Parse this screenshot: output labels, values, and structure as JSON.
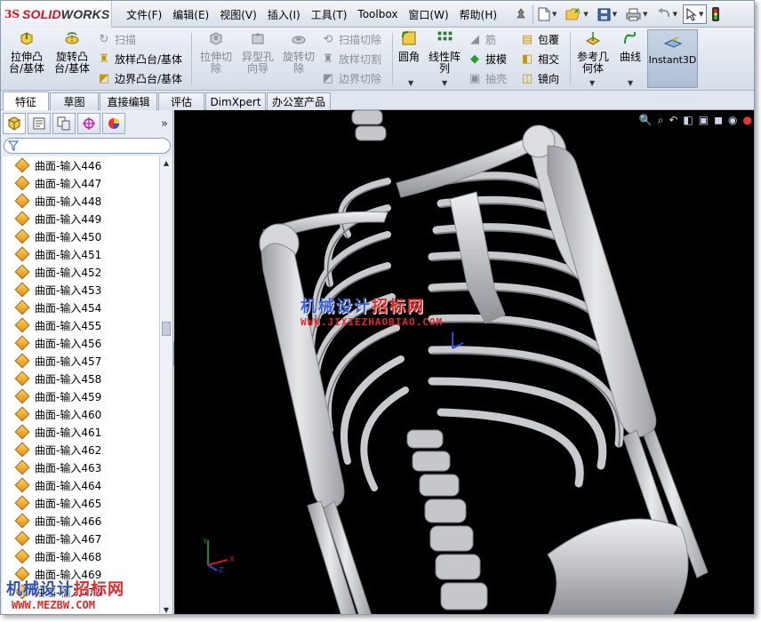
{
  "app": {
    "logo_ds": "3S",
    "logo_solid": "SOLID",
    "logo_works": "WORKS"
  },
  "menu": [
    "文件(F)",
    "编辑(E)",
    "视图(V)",
    "插入(I)",
    "工具(T)",
    "Toolbox",
    "窗口(W)",
    "帮助(H)"
  ],
  "quick_access": [
    {
      "icon": "pin-icon"
    },
    {
      "icon": "new-document-icon"
    },
    {
      "icon": "open-folder-icon"
    },
    {
      "icon": "save-icon"
    },
    {
      "icon": "print-icon"
    },
    {
      "icon": "undo-icon"
    },
    {
      "icon": "select-pointer-icon"
    },
    {
      "icon": "rebuild-traffic-light-icon"
    }
  ],
  "command_manager": {
    "extrude_boss": "拉伸凸\n台/基体",
    "revolve_boss": "旋转凸\n台/基体",
    "sweep": "扫描",
    "loft_boss": "放样凸台/基体",
    "boundary_boss": "边界凸台/基体",
    "extrude_cut": "拉伸切\n除",
    "hole_wizard": "异型孔\n向导",
    "revolve_cut": "旋转切\n除",
    "swept_cut": "扫描切除",
    "lofted_cut": "放样切割",
    "boundary_cut": "边界切除",
    "fillet": "圆角",
    "linear_pattern": "线性阵\n列",
    "rib": "筋",
    "draft": "拔模",
    "shell": "抽壳",
    "wrap": "包覆",
    "intersect": "相交",
    "mirror": "镜向",
    "ref_geometry": "参考几\n何体",
    "curves": "曲线",
    "instant3d": "Instant3D"
  },
  "tabs": [
    "特征",
    "草图",
    "直接编辑",
    "评估",
    "DimXpert",
    "办公室产品"
  ],
  "active_tab": "特征",
  "panel_tabs": [
    "feature-manager-icon",
    "property-manager-icon",
    "configuration-manager-icon",
    "dimxpert-manager-icon",
    "display-manager-icon"
  ],
  "panel_more": "»",
  "tree_items": [
    "曲面-输入446",
    "曲面-输入447",
    "曲面-输入448",
    "曲面-输入449",
    "曲面-输入450",
    "曲面-输入451",
    "曲面-输入452",
    "曲面-输入453",
    "曲面-输入454",
    "曲面-输入455",
    "曲面-输入456",
    "曲面-输入457",
    "曲面-输入458",
    "曲面-输入459",
    "曲面-输入460",
    "曲面-输入461",
    "曲面-输入462",
    "曲面-输入463",
    "曲面-输入464",
    "曲面-输入465",
    "曲面-输入466",
    "曲面-输入467",
    "曲面-输入468",
    "曲面-输入469",
    "曲面-输入470"
  ],
  "watermark": {
    "cn_blue": "机械设计",
    "cn_red": "招标网",
    "url": "WWW.JIXIEZHAOBIAO.COM",
    "bottom_cn_blue": "机械设计",
    "bottom_cn_red": "招标网",
    "bottom_url": "WWW.MEZBW.COM"
  },
  "triad": {
    "x": "X",
    "y": "Y",
    "z": "Z"
  },
  "colors": {
    "viewport_bg": "#000000",
    "bone": "#d6d7da",
    "ui_bg": "#dfe6ef",
    "brand_red": "#d2141e"
  }
}
